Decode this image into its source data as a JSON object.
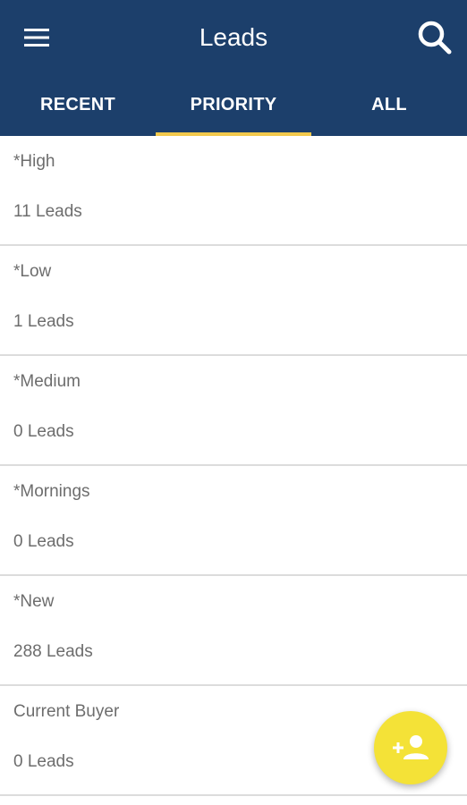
{
  "header": {
    "title": "Leads",
    "menu_icon": "hamburger-menu-icon",
    "search_icon": "search-icon",
    "background_color": "#1c3f6b"
  },
  "tabs": [
    {
      "label": "RECENT",
      "selected": false
    },
    {
      "label": "PRIORITY",
      "selected": true
    },
    {
      "label": "ALL",
      "selected": false
    }
  ],
  "tab_indicator_color": "#f2c94c",
  "lists": [
    {
      "name": "*High",
      "count": "11 Leads"
    },
    {
      "name": "*Low",
      "count": "1 Leads"
    },
    {
      "name": "*Medium",
      "count": "0 Leads"
    },
    {
      "name": "*Mornings",
      "count": "0 Leads"
    },
    {
      "name": "*New",
      "count": "288 Leads"
    },
    {
      "name": "Current Buyer",
      "count": "0 Leads"
    }
  ],
  "fab": {
    "icon": "add-person-icon",
    "color": "#f4e237"
  }
}
